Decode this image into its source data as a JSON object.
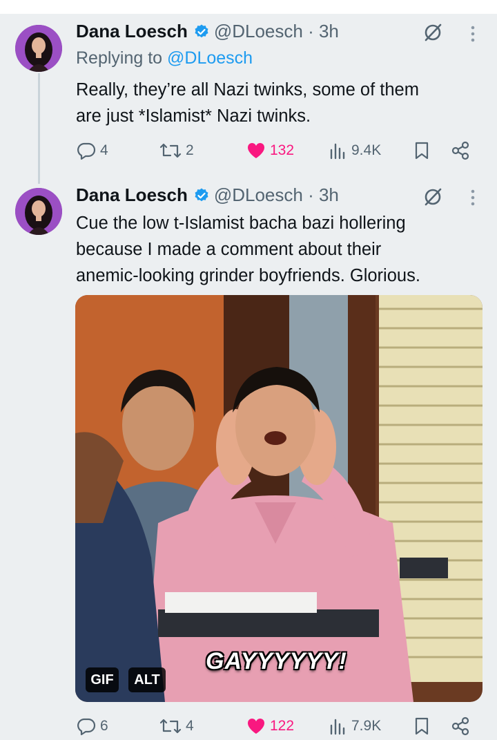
{
  "tweets": [
    {
      "author": {
        "name": "Dana Loesch",
        "handle": "@DLoesch",
        "time": "3h",
        "verified": true
      },
      "replying_prefix": "Replying to ",
      "replying_mention": "@DLoesch",
      "text": "Really, they’re all Nazi twinks, some of them\nare just *Islamist* Nazi twinks.",
      "stats": {
        "replies": "4",
        "reposts": "2",
        "likes": "132",
        "views": "9.4K"
      },
      "liked": true
    },
    {
      "author": {
        "name": "Dana Loesch",
        "handle": "@DLoesch",
        "time": "3h",
        "verified": true
      },
      "text": "Cue the low t-Islamist bacha bazi hollering\nbecause I made a comment about their\nanemic-looking grinder boyfriends. Glorious.",
      "media": {
        "type": "GIF",
        "badge_gif": "GIF",
        "badge_alt": "ALT",
        "caption": "GAYYYYYY!"
      },
      "stats": {
        "replies": "6",
        "reposts": "4",
        "likes": "122",
        "views": "7.9K"
      },
      "liked": true
    }
  ],
  "icons": {
    "verified": "verified-badge-icon",
    "grok": "grok-icon",
    "more": "more-vertical-icon",
    "reply": "reply-icon",
    "repost": "repost-icon",
    "like": "heart-icon",
    "views": "views-icon",
    "bookmark": "bookmark-icon",
    "share": "share-icon"
  },
  "colors": {
    "background": "#eceff1",
    "link": "#1d9bf0",
    "like": "#f91880",
    "muted": "#536471"
  }
}
